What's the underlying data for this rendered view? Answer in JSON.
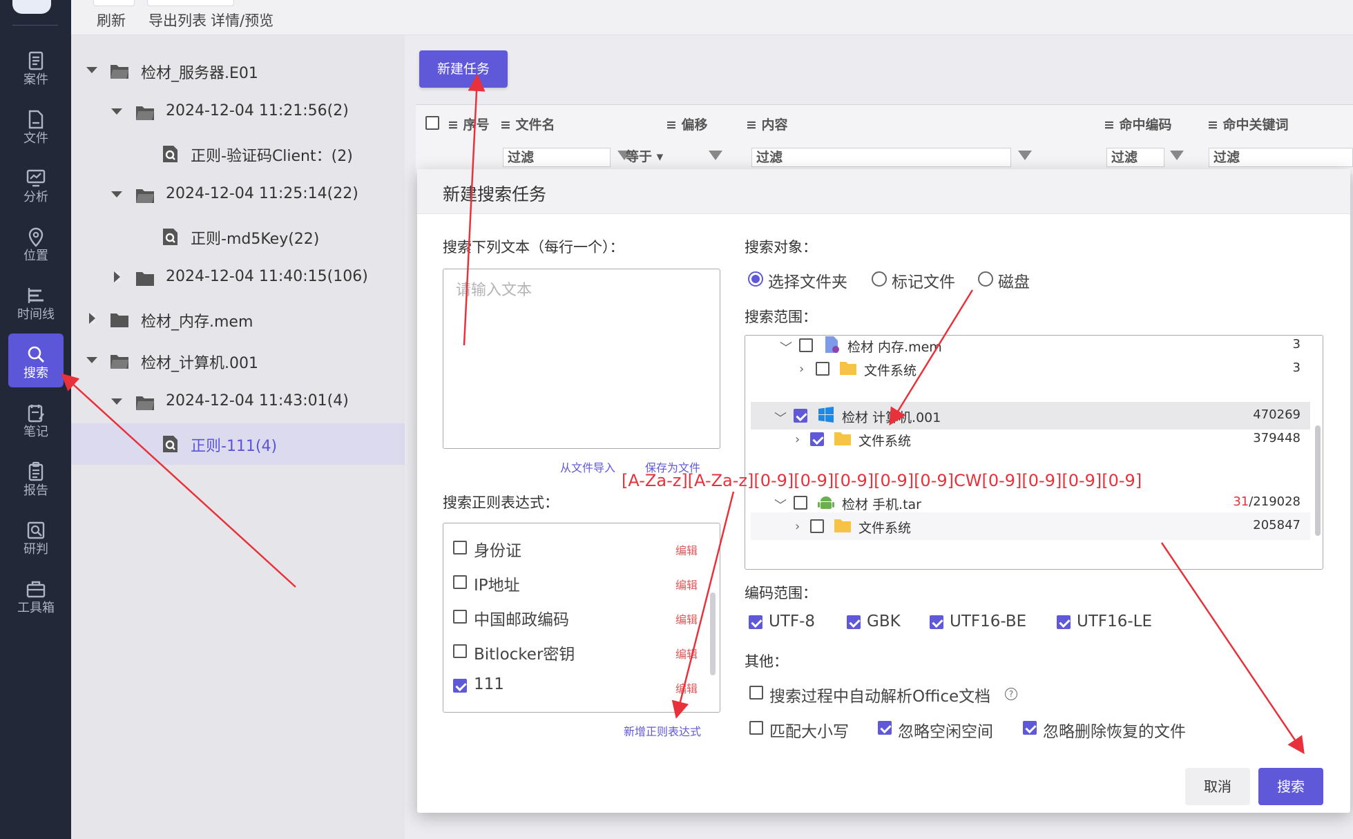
{
  "toolbar": {
    "refresh": "刷新",
    "export": "导出列表",
    "detail": "详情/预览"
  },
  "nav": [
    {
      "label": "案件",
      "icon": "case-icon"
    },
    {
      "label": "文件",
      "icon": "file-icon"
    },
    {
      "label": "分析",
      "icon": "analysis-icon"
    },
    {
      "label": "位置",
      "icon": "location-icon"
    },
    {
      "label": "时间线",
      "icon": "timeline-icon"
    },
    {
      "label": "搜索",
      "icon": "search-icon",
      "active": true
    },
    {
      "label": "笔记",
      "icon": "note-icon"
    },
    {
      "label": "报告",
      "icon": "report-icon"
    },
    {
      "label": "研判",
      "icon": "judge-icon"
    },
    {
      "label": "工具箱",
      "icon": "toolbox-icon"
    }
  ],
  "tree": [
    {
      "label": "检材_服务器.E01",
      "level": 0,
      "expanded": true,
      "kind": "folder-open"
    },
    {
      "label": "2024-12-04 11:21:56(2)",
      "level": 1,
      "expanded": true,
      "kind": "folder-open"
    },
    {
      "label": "正则-验证码Client：(2)",
      "level": 2,
      "kind": "search-result"
    },
    {
      "label": "2024-12-04 11:25:14(22)",
      "level": 1,
      "expanded": true,
      "kind": "folder-open"
    },
    {
      "label": "正则-md5Key(22)",
      "level": 2,
      "kind": "search-result"
    },
    {
      "label": "2024-12-04 11:40:15(106)",
      "level": 1,
      "expanded": false,
      "kind": "folder"
    },
    {
      "label": "检材_内存.mem",
      "level": 0,
      "expanded": false,
      "kind": "folder"
    },
    {
      "label": "检材_计算机.001",
      "level": 0,
      "expanded": true,
      "kind": "folder-open"
    },
    {
      "label": "2024-12-04 11:43:01(4)",
      "level": 1,
      "expanded": true,
      "kind": "folder-open"
    },
    {
      "label": "正则-111(4)",
      "level": 2,
      "kind": "search-result",
      "selected": true
    }
  ],
  "main": {
    "new_task": "新建任务",
    "columns": [
      "序号",
      "文件名",
      "偏移",
      "内容",
      "命中编码",
      "命中关键词"
    ],
    "filter_placeholder": "过滤",
    "offset_op": "等于"
  },
  "modal": {
    "title": "新建搜索任务",
    "text_label": "搜索下列文本（每行一个）：",
    "text_placeholder": "请输入文本",
    "import_link": "从文件导入",
    "save_link": "保存为文件",
    "regex_label": "搜索正则表达式：",
    "edit_label": "编辑",
    "regex_items": [
      {
        "label": "身份证",
        "checked": false
      },
      {
        "label": "IP地址",
        "checked": false
      },
      {
        "label": "中国邮政编码",
        "checked": false
      },
      {
        "label": "Bitlocker密钥",
        "checked": false
      },
      {
        "label": "111",
        "checked": true
      }
    ],
    "add_regex": "新增正则表达式",
    "target_label": "搜索对象：",
    "targets": [
      {
        "label": "选择文件夹",
        "selected": true
      },
      {
        "label": "标记文件",
        "selected": false
      },
      {
        "label": "磁盘",
        "selected": false
      }
    ],
    "scope_label": "搜索范围：",
    "scope_rows": [
      {
        "label": "检材 内存.mem",
        "count": "3",
        "checked": false,
        "level": 0,
        "expanded": true,
        "icon": "memory-file-icon"
      },
      {
        "label": "文件系统",
        "count": "3",
        "checked": false,
        "level": 1,
        "expanded": false,
        "icon": "folder-icon"
      },
      {
        "label": "检材 计算机.001",
        "count": "470269",
        "checked": true,
        "level": 0,
        "expanded": true,
        "icon": "windows-icon",
        "highlight": true
      },
      {
        "label": "文件系统",
        "count": "379448",
        "checked": true,
        "level": 1,
        "expanded": false,
        "icon": "folder-icon"
      },
      {
        "label": "检材 手机.tar",
        "count_hit": "31",
        "count": "/219028",
        "checked": false,
        "level": 0,
        "expanded": true,
        "icon": "android-icon"
      },
      {
        "label": "文件系统",
        "count": "205847",
        "checked": false,
        "level": 1,
        "expanded": false,
        "icon": "folder-icon",
        "shaded": true
      }
    ],
    "encoding_label": "编码范围：",
    "encodings": [
      {
        "label": "UTF-8",
        "checked": true
      },
      {
        "label": "GBK",
        "checked": true
      },
      {
        "label": "UTF16-BE",
        "checked": true
      },
      {
        "label": "UTF16-LE",
        "checked": true
      }
    ],
    "other_label": "其他：",
    "other_options": [
      {
        "label": "搜索过程中自动解析Office文档",
        "checked": false,
        "help": "?"
      },
      {
        "label": "匹配大小写",
        "checked": false
      },
      {
        "label": "忽略空闲空间",
        "checked": true
      },
      {
        "label": "忽略删除恢复的文件",
        "checked": true
      }
    ],
    "cancel": "取消",
    "search": "搜索"
  },
  "annotation": "[A-Za-z][A-Za-z][0-9][0-9][0-9][0-9][0-9]CW[0-9][0-9][0-9][0-9]",
  "colors": {
    "accent": "#5f58d8",
    "rail": "#232838",
    "annotation": "#e8313a"
  }
}
